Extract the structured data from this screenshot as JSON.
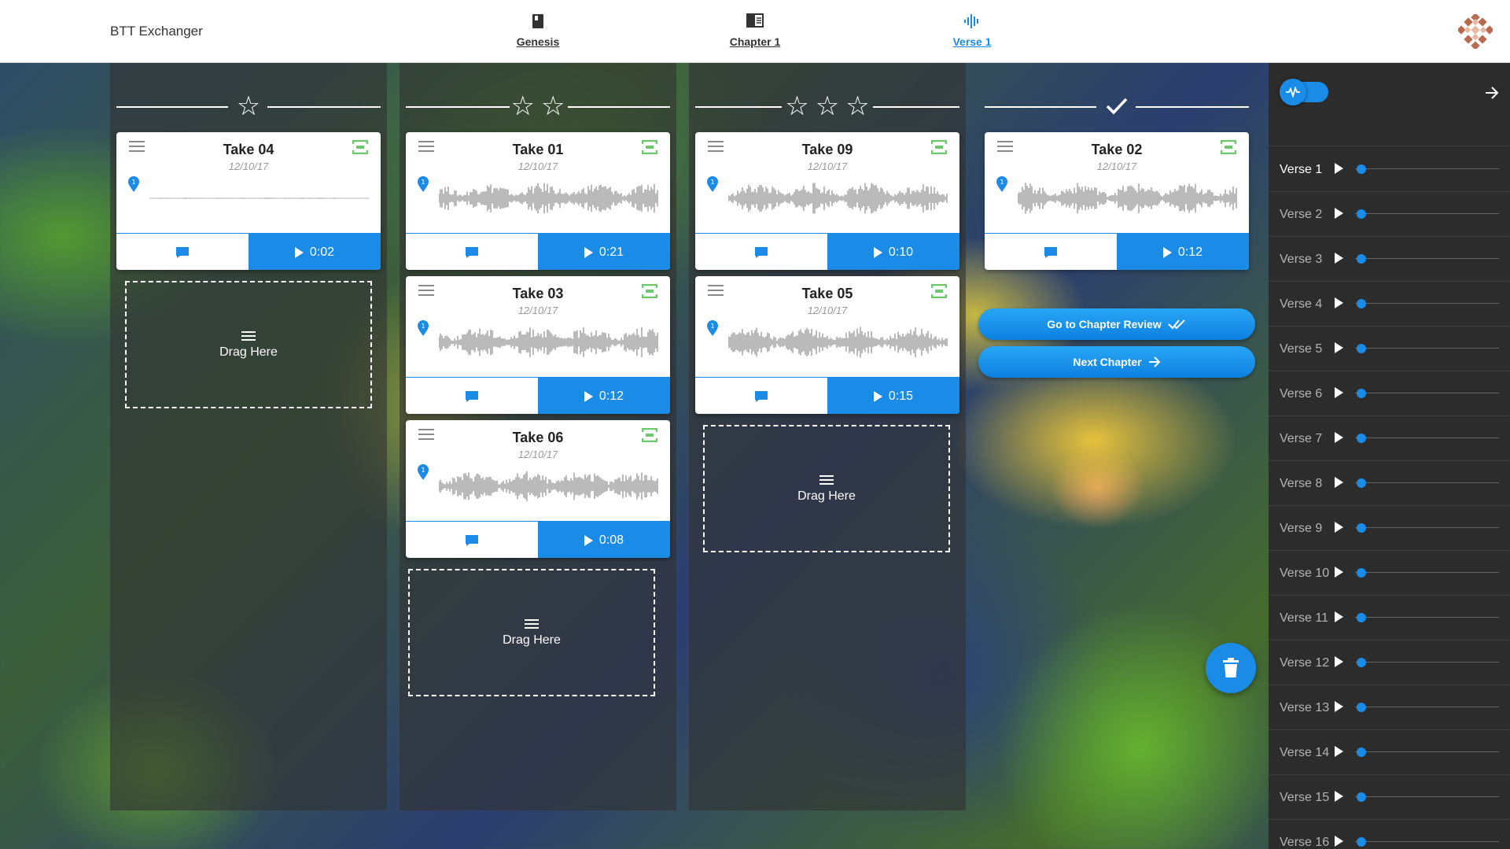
{
  "app": {
    "title": "BTT Exchanger"
  },
  "breadcrumbs": [
    {
      "label": "Genesis",
      "icon": "book-icon",
      "active": false
    },
    {
      "label": "Chapter 1",
      "icon": "chapter-icon",
      "active": false
    },
    {
      "label": "Verse 1",
      "icon": "audio-wave-icon",
      "active": true
    }
  ],
  "columns": [
    {
      "rating": 1,
      "takes": [
        {
          "title": "Take 04",
          "date": "12/10/17",
          "duration": "0:02"
        }
      ],
      "drag_label": "Drag Here"
    },
    {
      "rating": 2,
      "takes": [
        {
          "title": "Take 01",
          "date": "12/10/17",
          "duration": "0:21"
        },
        {
          "title": "Take 03",
          "date": "12/10/17",
          "duration": "0:12"
        },
        {
          "title": "Take 06",
          "date": "12/10/17",
          "duration": "0:08"
        }
      ],
      "drag_label": "Drag Here"
    },
    {
      "rating": 3,
      "takes": [
        {
          "title": "Take 09",
          "date": "12/10/17",
          "duration": "0:10"
        },
        {
          "title": "Take 05",
          "date": "12/10/17",
          "duration": "0:15"
        }
      ],
      "drag_label": "Drag Here"
    },
    {
      "rating": "approved",
      "takes": [
        {
          "title": "Take 02",
          "date": "12/10/17",
          "duration": "0:12"
        }
      ]
    }
  ],
  "buttons": {
    "chapter_review": "Go to Chapter Review",
    "next_chapter": "Next Chapter"
  },
  "sidebar": {
    "verses": [
      "Verse 1",
      "Verse 2",
      "Verse 3",
      "Verse 4",
      "Verse 5",
      "Verse 6",
      "Verse 7",
      "Verse 8",
      "Verse 9",
      "Verse 10",
      "Verse 11",
      "Verse 12",
      "Verse 13",
      "Verse 14",
      "Verse 15",
      "Verse 16"
    ],
    "active_index": 0
  },
  "colors": {
    "accent": "#1a8ce8",
    "record_icon": "#6cc86a",
    "panel": "#2c2c2c"
  }
}
